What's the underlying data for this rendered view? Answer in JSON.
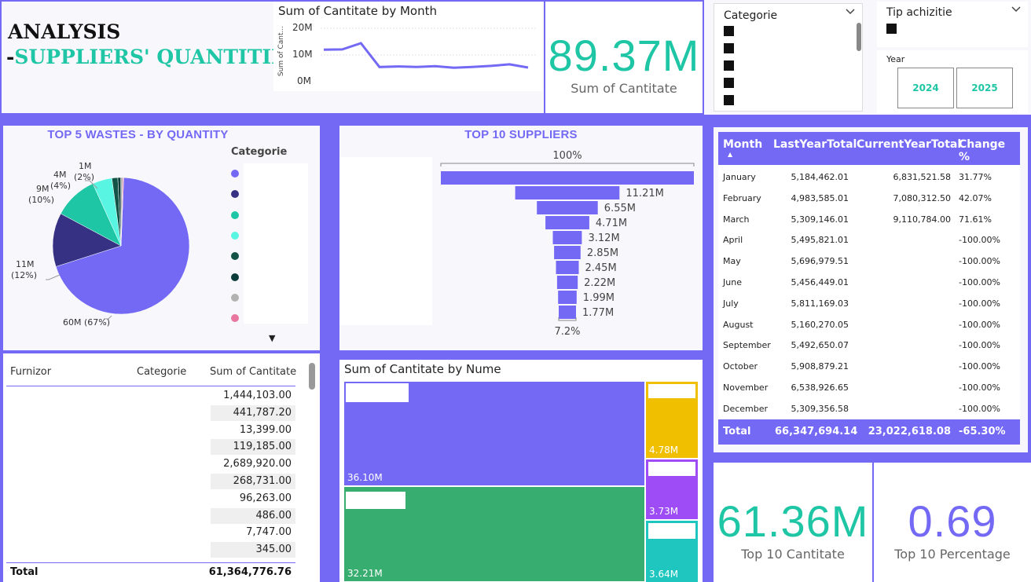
{
  "header": {
    "title_line1": "ANALYSIS",
    "title_dash_left": "-",
    "title_line2": "SUPPLIERS' QUANTITIES",
    "title_dash_right": "-"
  },
  "month_chart": {
    "title": "Sum of Cantitate by Month",
    "ylabel": "Sum of Cant...",
    "ticks": [
      "20M",
      "10M",
      "0M"
    ],
    "color": "#7469f4"
  },
  "kpi_total": {
    "value": "89.37M",
    "label": "Sum of Cantitate"
  },
  "slicer_categorie": {
    "title": "Categorie",
    "chevron": "chevron-down-icon"
  },
  "slicer_tip": {
    "title": "Tip achizitie",
    "chevron": "chevron-down-icon"
  },
  "slicer_year": {
    "title": "Year",
    "options": [
      "2024",
      "2025"
    ]
  },
  "pie": {
    "title": "TOP 5 WASTES - BY QUANTITY",
    "legend_title": "Categorie",
    "labels": {
      "big": "60M (67%)",
      "s11": "11M",
      "s11p": "(12%)",
      "s9": "9M",
      "s9p": "(10%)",
      "s4": "4M",
      "s4p": "(4%)",
      "s1": "1M",
      "s1p": "(2%)"
    },
    "legend_colors": [
      "#7469f4",
      "#373183",
      "#1fc6a5",
      "#58f5e3",
      "#135347",
      "#0d3d3a",
      "#b2b2b2",
      "#e8779e"
    ],
    "more": "▼"
  },
  "chart_data": [
    {
      "type": "line",
      "title": "Sum of Cantitate by Month",
      "ylabel": "Sum of Cant...",
      "x": [
        1,
        2,
        3,
        4,
        5,
        6,
        7,
        8,
        9,
        10,
        11,
        12
      ],
      "values": [
        12.0,
        12.1,
        14.4,
        5.5,
        5.7,
        5.5,
        5.8,
        5.2,
        5.5,
        5.9,
        6.5,
        5.3
      ],
      "ylim": [
        0,
        22
      ]
    },
    {
      "type": "pie",
      "title": "TOP 5 WASTES - BY QUANTITY",
      "values": [
        60,
        11,
        9,
        4,
        1.2,
        0.6,
        0.4,
        0.2
      ],
      "colors": [
        "#7469f4",
        "#373183",
        "#1fc6a5",
        "#58f5e3",
        "#135347",
        "#0d3d3a",
        "#b2b2b2",
        "#e8779e"
      ]
    },
    {
      "type": "bar",
      "title": "TOP 10 SUPPLIERS",
      "values": [
        27.2,
        11.21,
        6.55,
        4.71,
        3.12,
        2.85,
        2.45,
        2.22,
        1.99,
        1.77
      ],
      "value_labels": [
        "",
        "11.21M",
        "6.55M",
        "4.71M",
        "3.12M",
        "2.85M",
        "2.45M",
        "2.22M",
        "1.99M",
        "1.77M"
      ],
      "top_label": "100%",
      "bottom_label": "7.2%"
    }
  ],
  "top_suppliers": {
    "title": "TOP 10 SUPPLIERS"
  },
  "year_table": {
    "headers": [
      "Month",
      "LastYearTotal",
      "CurrentYearTotal",
      "Change %"
    ],
    "rows": [
      [
        "January",
        "5,184,462.01",
        "6,831,521.58",
        "31.77%"
      ],
      [
        "February",
        "4,983,585.01",
        "7,080,312.50",
        "42.07%"
      ],
      [
        "March",
        "5,309,146.01",
        "9,110,784.00",
        "71.61%"
      ],
      [
        "April",
        "5,495,821.01",
        "",
        "-100.00%"
      ],
      [
        "May",
        "5,696,979.51",
        "",
        "-100.00%"
      ],
      [
        "June",
        "5,456,449.01",
        "",
        "-100.00%"
      ],
      [
        "July",
        "5,811,169.03",
        "",
        "-100.00%"
      ],
      [
        "August",
        "5,160,270.05",
        "",
        "-100.00%"
      ],
      [
        "September",
        "5,492,650.07",
        "",
        "-100.00%"
      ],
      [
        "October",
        "5,908,879.21",
        "",
        "-100.00%"
      ],
      [
        "November",
        "6,538,926.65",
        "",
        "-100.00%"
      ],
      [
        "December",
        "5,309,356.58",
        "",
        "-100.00%"
      ]
    ],
    "total": [
      "Total",
      "66,347,694.14",
      "23,022,618.08",
      "-65.30%"
    ],
    "sort_icon": "▲"
  },
  "furnizor_table": {
    "headers": [
      "Furnizor",
      "Categorie",
      "Sum of Cantitate"
    ],
    "values": [
      "1,444,103.00",
      "441,787.20",
      "13,399.00",
      "119,185.00",
      "2,689,920.00",
      "268,731.00",
      "96,263.00",
      "486.00",
      "7,747.00",
      "345.00"
    ],
    "total_label": "Total",
    "total_value": "61,364,776.76"
  },
  "treemap": {
    "title": "Sum of Cantitate by Nume",
    "tiles": [
      {
        "label": "36.10M",
        "color": "#7469f4"
      },
      {
        "label": "32.21M",
        "color": "#38ad70"
      },
      {
        "label": "4.78M",
        "color": "#efbf00"
      },
      {
        "label": "3.73M",
        "color": "#9e4cf5"
      },
      {
        "label": "3.64M",
        "color": "#1fc6c0"
      }
    ]
  },
  "kpi_top10": {
    "value": "61.36M",
    "label": "Top 10 Cantitate"
  },
  "kpi_pct": {
    "value": "0.69",
    "label": "Top 10 Percentage"
  }
}
